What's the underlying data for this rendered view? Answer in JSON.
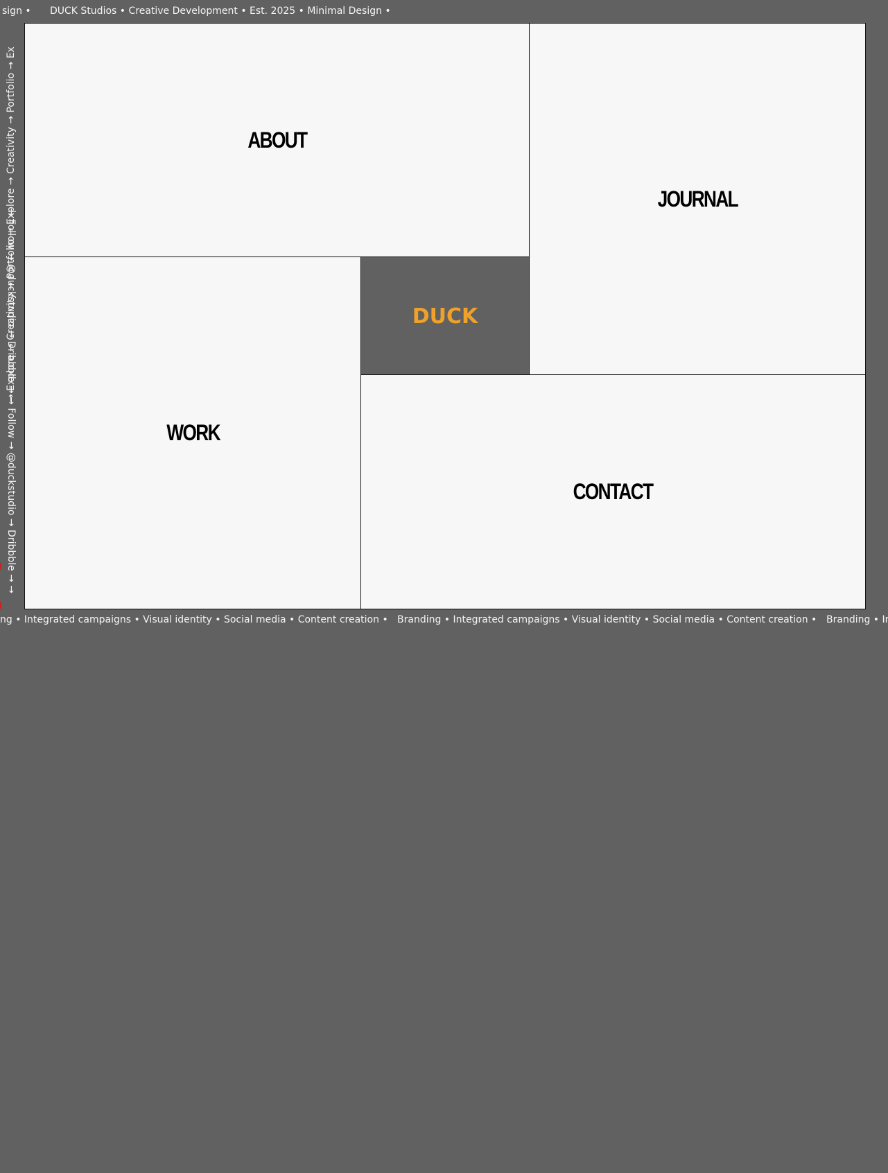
{
  "header_ticker": {
    "segment_lead": "sign •",
    "segment_main": "DUCK Studios • Creative Development • Est. 2025 • Minimal Design •"
  },
  "footer_ticker": {
    "segment_lead": "ng • Integrated campaigns • Visual identity • Social media • Content creation •",
    "segment_main": "Branding • Integrated campaigns • Visual identity • Social media • Content creation •",
    "segment_tail": "Branding • In"
  },
  "left_ticker": {
    "text": "→ Explore → Creativity → Portfolio → Explore → Creativity → Portfolio → Ex"
  },
  "right_ticker": {
    "text": "→ Follow → @duckstudio → Dribbble → → Follow → @duckstudio → Dribbble → →"
  },
  "nav": {
    "about": "ABOUT",
    "journal": "JOURNAL",
    "work": "WORK",
    "contact": "CONTACT"
  },
  "logo": {
    "text": "DUCK",
    "color": "#f0a12a"
  },
  "colors": {
    "frame": "#616161",
    "panel": "#f7f7f7",
    "border": "#111111"
  }
}
